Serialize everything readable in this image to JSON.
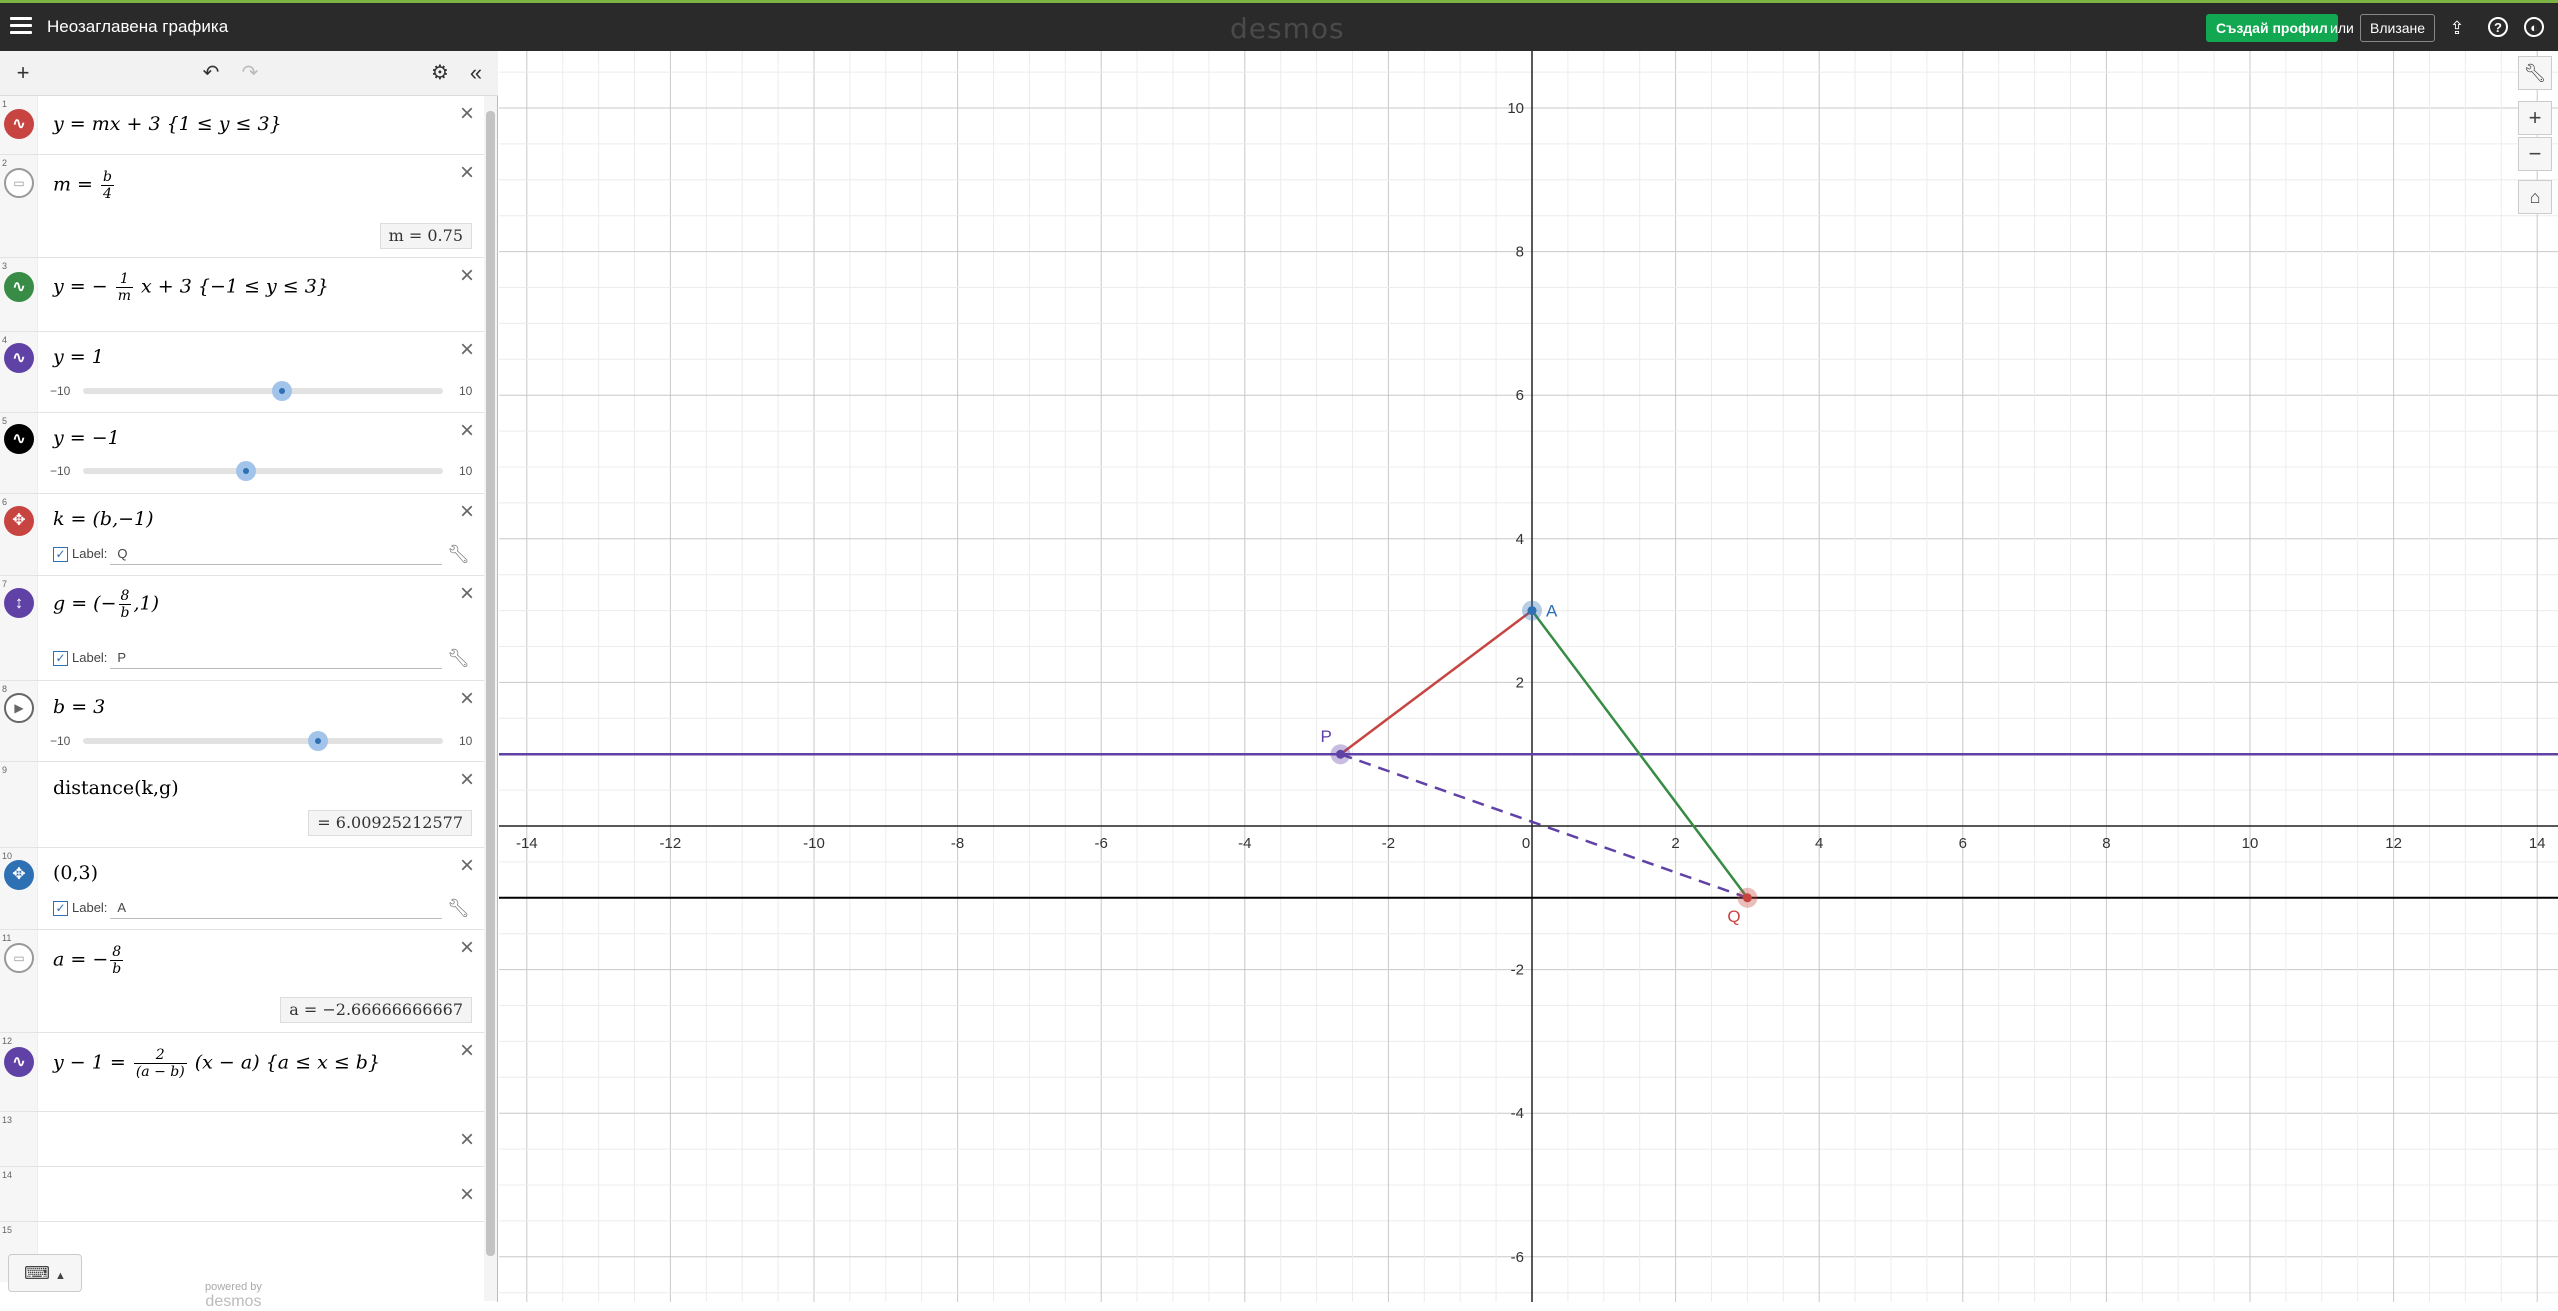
{
  "app": {
    "title": "Неозаглавена графика",
    "logo": "desmos",
    "signup_label": "Създай профил",
    "or_label": "или",
    "login_label": "Влизане",
    "icons": [
      "hamburger-icon",
      "share-icon",
      "help-icon",
      "globe-icon"
    ]
  },
  "panel": {
    "powered_by": "powered by",
    "powered_brand": "desmos",
    "expressions": [
      {
        "index": "1",
        "icon": "graph-icon",
        "color": "#c74440",
        "latex": "y = mx + 3 {1 ≤ y ≤ 3}"
      },
      {
        "index": "2",
        "icon": "hidden-icon",
        "color": "#999999",
        "latex_lhs": "m =",
        "frac_num": "b",
        "frac_den": "4",
        "result": "m  =  0.75"
      },
      {
        "index": "3",
        "icon": "graph-icon",
        "color": "#388c46",
        "latex_lhs": "y = −",
        "frac_num": "1",
        "frac_den": "m",
        "latex_rhs": "x + 3 {−1 ≤ y ≤ 3}"
      },
      {
        "index": "4",
        "icon": "graph-icon",
        "color": "#6042a6",
        "latex": "y = 1",
        "slider_min": "−10",
        "slider_max": "10",
        "slider_value": 1
      },
      {
        "index": "5",
        "icon": "graph-icon",
        "color": "#000000",
        "latex": "y = −1",
        "slider_min": "−10",
        "slider_max": "10",
        "slider_value": -1
      },
      {
        "index": "6",
        "icon": "move-icon",
        "color": "#c74440",
        "latex": "k = (b,−1)",
        "label_text": "Label:",
        "label_value": "Q"
      },
      {
        "index": "7",
        "icon": "move-vertical-icon",
        "color": "#6042a6",
        "latex_lhs": "g = (−",
        "frac_num": "8",
        "frac_den": "b",
        "latex_rhs": ",1)",
        "label_text": "Label:",
        "label_value": "P"
      },
      {
        "index": "8",
        "icon": "play-icon",
        "color": "#999999",
        "latex": "b = 3",
        "slider_min": "−10",
        "slider_max": "10",
        "slider_value": 3
      },
      {
        "index": "9",
        "icon": "none",
        "color": "#ffffff",
        "latex": "distance(k,g)",
        "result": "=  6.00925212577"
      },
      {
        "index": "10",
        "icon": "move-icon",
        "color": "#2d70b3",
        "latex": "(0,3)",
        "label_text": "Label:",
        "label_value": "A"
      },
      {
        "index": "11",
        "icon": "hidden-icon",
        "color": "#999999",
        "latex_lhs": "a = −",
        "frac_num": "8",
        "frac_den": "b",
        "result": "a  =  −2.66666666667"
      },
      {
        "index": "12",
        "icon": "graph-icon",
        "color": "#6042a6",
        "latex_lhs": "y − 1 =",
        "frac_num": "2",
        "frac_den": "(a − b)",
        "latex_rhs": "(x − a) {a ≤ x ≤ b}"
      },
      {
        "index": "13"
      },
      {
        "index": "14"
      },
      {
        "index": "15"
      }
    ]
  },
  "graph": {
    "x_ticks": [
      "-14",
      "-12",
      "-10",
      "-8",
      "-6",
      "-4",
      "-2",
      "0",
      "2",
      "4",
      "6",
      "8",
      "10",
      "12",
      "14"
    ],
    "y_ticks": [
      "10",
      "8",
      "6",
      "4",
      "2",
      "-2",
      "-4",
      "-6"
    ],
    "point_labels": {
      "A": "A",
      "P": "P",
      "Q": "Q"
    },
    "points": {
      "A": [
        0,
        3
      ],
      "P": [
        -2.6667,
        1
      ],
      "Q": [
        3,
        -1
      ]
    },
    "colors": {
      "red": "#c74440",
      "green": "#388c46",
      "purple": "#6042a6",
      "blue": "#2d70b3"
    },
    "tools": [
      "wrench-icon",
      "zoom-in-icon",
      "zoom-out-icon",
      "home-icon"
    ]
  }
}
